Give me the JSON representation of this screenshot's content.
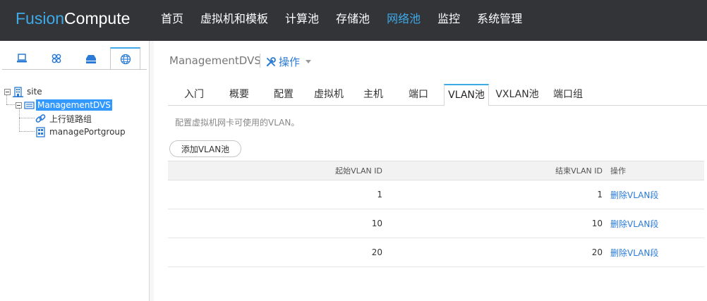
{
  "brand": {
    "part1": "Fusion",
    "part2": "Compute"
  },
  "nav": [
    {
      "label": "首页"
    },
    {
      "label": "虚拟机和模板"
    },
    {
      "label": "计算池"
    },
    {
      "label": "存储池"
    },
    {
      "label": "网络池",
      "active": true
    },
    {
      "label": "监控"
    },
    {
      "label": "系统管理"
    }
  ],
  "left_tabs": [
    {
      "icon": "computer-icon"
    },
    {
      "icon": "cluster-icon"
    },
    {
      "icon": "storage-icon"
    },
    {
      "icon": "globe-icon",
      "active": true
    }
  ],
  "tree": {
    "site": "site",
    "dvs": "ManagementDVS",
    "uplink": "上行链路组",
    "portgroup": "managePortgroup"
  },
  "header": {
    "breadcrumb": "ManagementDVS",
    "operations": "操作"
  },
  "tabs": [
    {
      "label": "入门"
    },
    {
      "label": "概要"
    },
    {
      "label": "配置"
    },
    {
      "label": "虚拟机"
    },
    {
      "label": "主机"
    },
    {
      "label": "端口"
    },
    {
      "label": "VLAN池",
      "active": true
    },
    {
      "label": "VXLAN池"
    },
    {
      "label": "端口组"
    }
  ],
  "description": "配置虚拟机网卡可使用的VLAN。",
  "add_button": "添加VLAN池",
  "table": {
    "headers": {
      "start": "起始VLAN ID",
      "end": "结束VLAN ID",
      "op": "操作"
    },
    "rows": [
      {
        "start": "1",
        "end": "1",
        "op": "删除VLAN段"
      },
      {
        "start": "10",
        "end": "10",
        "op": "删除VLAN段"
      },
      {
        "start": "20",
        "end": "20",
        "op": "删除VLAN段"
      }
    ]
  },
  "colors": {
    "accent": "#3eaae8",
    "link": "#2b7bd6",
    "topbar": "#333438",
    "selected": "#3399ff"
  }
}
